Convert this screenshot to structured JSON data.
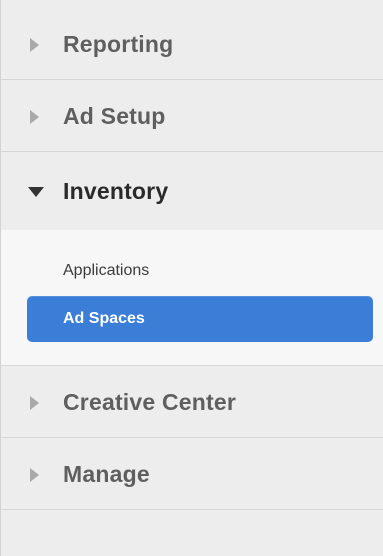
{
  "nav": {
    "sections": [
      {
        "label": "Reporting",
        "icon": "chevron-right-icon",
        "expanded": false
      },
      {
        "label": "Ad Setup",
        "icon": "chevron-right-icon",
        "expanded": false
      },
      {
        "label": "Inventory",
        "icon": "chevron-down-icon",
        "expanded": true
      },
      {
        "label": "Creative Center",
        "icon": "chevron-right-icon",
        "expanded": false
      },
      {
        "label": "Manage",
        "icon": "chevron-right-icon",
        "expanded": false
      }
    ],
    "inventory_items": [
      {
        "label": "Applications",
        "active": false
      },
      {
        "label": "Ad Spaces",
        "active": true
      }
    ]
  },
  "colors": {
    "background": "#ededed",
    "active_item": "#3a7ed7",
    "section_text": "#5f5f5f",
    "expanded_text": "#2a2a2a",
    "chevron": "#a9a9a9"
  }
}
